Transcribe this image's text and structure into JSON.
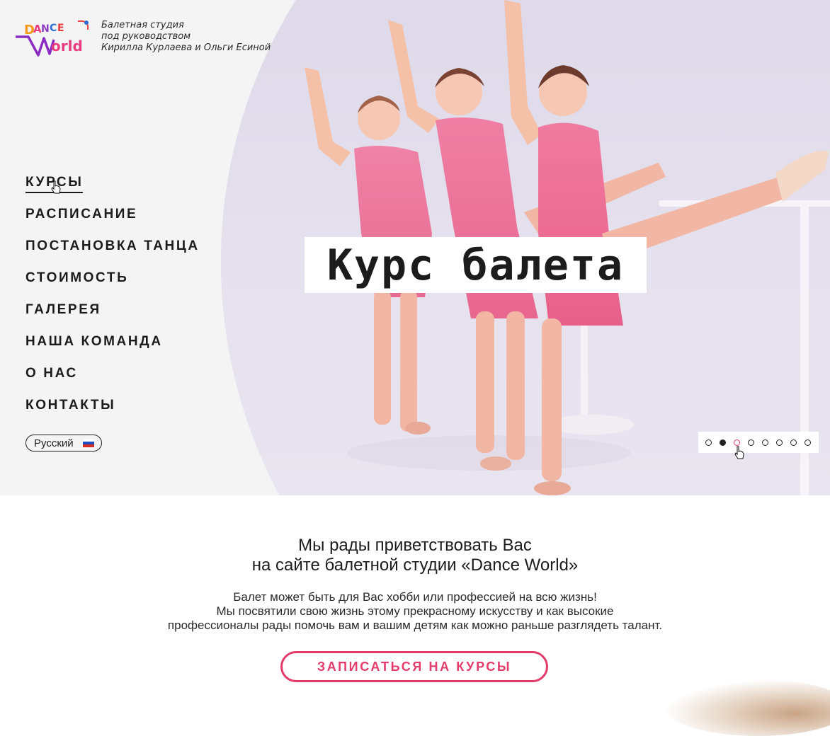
{
  "header": {
    "logo_alt": "Dance World",
    "tagline_lines": [
      "Балетная студия",
      "под руководством",
      "Кирилла Курлаева и Ольги Есиной"
    ]
  },
  "nav": {
    "items": [
      {
        "label": "КУРСЫ",
        "active": true
      },
      {
        "label": "РАСПИСАНИЕ"
      },
      {
        "label": "ПОСТАНОВКА ТАНЦА"
      },
      {
        "label": "СТОИМОСТЬ"
      },
      {
        "label": "ГАЛЕРЕЯ"
      },
      {
        "label": "НАША КОМАНДА"
      },
      {
        "label": "О НАС"
      },
      {
        "label": "КОНТАКТЫ"
      }
    ]
  },
  "language": {
    "label": "Русский",
    "icon": "russia-flag-icon"
  },
  "hero": {
    "title": "Курс балета",
    "slider": {
      "count": 8,
      "active_index": 1,
      "hover_index": 2
    }
  },
  "welcome": {
    "title_lines": [
      "Мы рады приветствовать Вас",
      "на сайте балетной студии «Dance World»"
    ],
    "text_lines": [
      "Балет может быть для Вас хобби или профессией на всю жизнь!",
      "Мы посвятили свою жизнь этому прекрасному искусству и как высокие",
      "профессионалы рады помочь вам и вашим детям как можно раньше разглядеть талант."
    ],
    "cta_label": "ЗАПИСАТЬСЯ НА КУРСЫ"
  },
  "colors": {
    "accent": "#e33c6a",
    "text": "#1c1c1c",
    "hero_bg": "#f4f4f5"
  }
}
